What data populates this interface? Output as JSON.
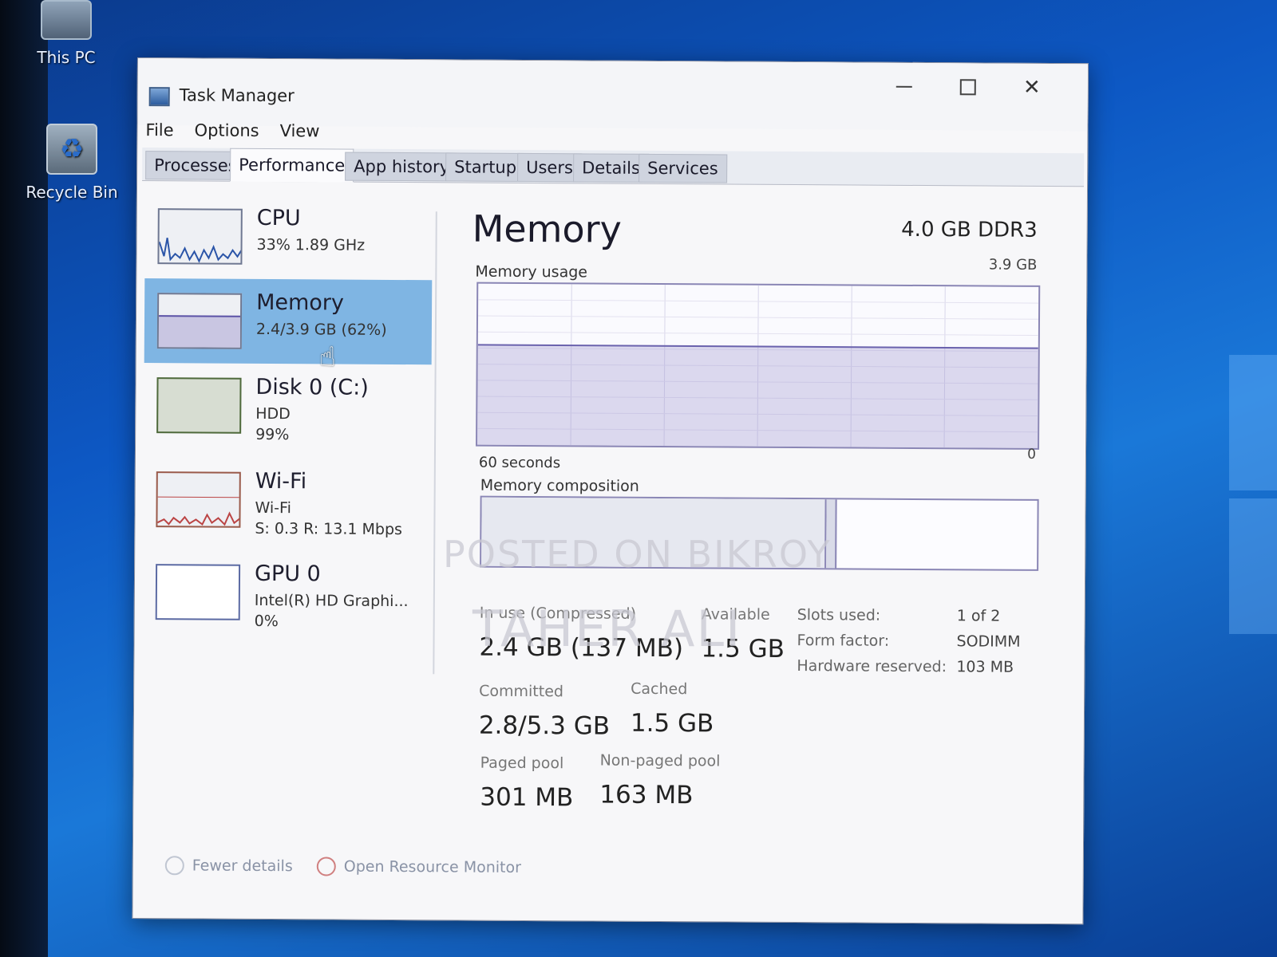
{
  "desktop": {
    "icons": [
      {
        "label": "This PC",
        "icon": "computer-icon"
      },
      {
        "label": "Recycle Bin",
        "icon": "recycle-bin-icon"
      }
    ]
  },
  "window": {
    "title": "Task Manager",
    "controls": {
      "minimize": "minimize-icon",
      "maximize": "maximize-icon",
      "close": "close-icon"
    }
  },
  "menu": [
    "File",
    "Options",
    "View"
  ],
  "tabs": [
    {
      "label": "Processes",
      "active": false
    },
    {
      "label": "Performance",
      "active": true
    },
    {
      "label": "App history",
      "active": false
    },
    {
      "label": "Startup",
      "active": false
    },
    {
      "label": "Users",
      "active": false
    },
    {
      "label": "Details",
      "active": false
    },
    {
      "label": "Services",
      "active": false
    }
  ],
  "sidebar": {
    "items": [
      {
        "name": "CPU",
        "line1": "33%  1.89 GHz",
        "line2": "",
        "selected": false
      },
      {
        "name": "Memory",
        "line1": "2.4/3.9 GB (62%)",
        "line2": "",
        "selected": true
      },
      {
        "name": "Disk 0 (C:)",
        "line1": "HDD",
        "line2": "99%",
        "selected": false
      },
      {
        "name": "Wi-Fi",
        "line1": "Wi-Fi",
        "line2": "S: 0.3  R: 13.1 Mbps",
        "selected": false
      },
      {
        "name": "GPU 0",
        "line1": "Intel(R) HD Graphi...",
        "line2": "0%",
        "selected": false
      }
    ]
  },
  "memory": {
    "title": "Memory",
    "spec": "4.0 GB DDR3",
    "usage_label": "Memory usage",
    "usage_max": "3.9 GB",
    "axis_left": "60 seconds",
    "axis_right": "0",
    "composition_label": "Memory composition",
    "usage_fraction": 0.62,
    "composition": {
      "in_use_fraction": 0.62,
      "modified_fraction": 0.02
    },
    "stats": {
      "in_use": {
        "label": "In use (Compressed)",
        "value": "2.4 GB (137 MB)"
      },
      "available": {
        "label": "Available",
        "value": "1.5 GB"
      },
      "committed": {
        "label": "Committed",
        "value": "2.8/5.3 GB"
      },
      "cached": {
        "label": "Cached",
        "value": "1.5 GB"
      },
      "paged": {
        "label": "Paged pool",
        "value": "301 MB"
      },
      "nonpaged": {
        "label": "Non-paged pool",
        "value": "163 MB"
      }
    },
    "specs": [
      {
        "key": "Slots used:",
        "value": "1 of 2"
      },
      {
        "key": "Form factor:",
        "value": "SODIMM"
      },
      {
        "key": "Hardware reserved:",
        "value": "103 MB"
      }
    ]
  },
  "footer": {
    "fewer": "Fewer details",
    "monitor": "Open Resource Monitor"
  },
  "watermark": {
    "line1": "POSTED ON BIKROY",
    "line2": "TAHER ALI"
  }
}
